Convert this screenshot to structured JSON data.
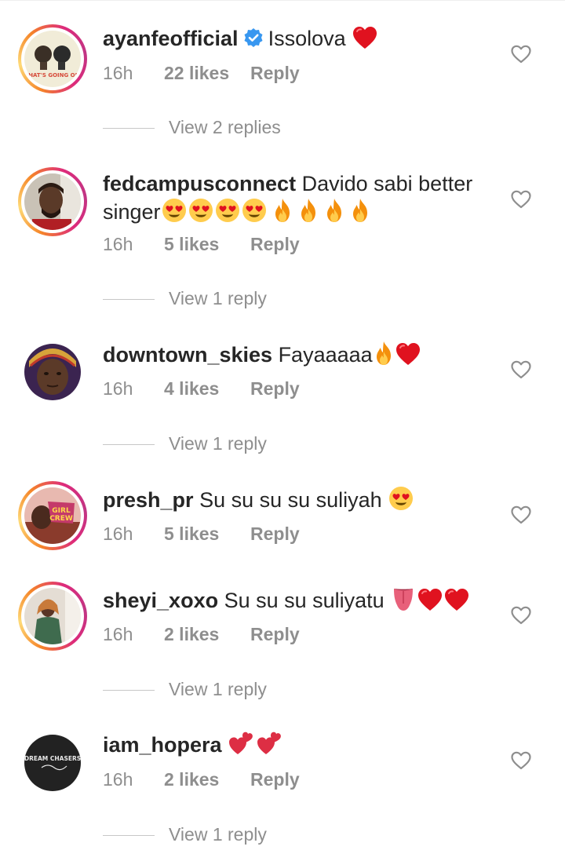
{
  "comments": [
    {
      "username": "ayanfeofficial",
      "verified": true,
      "text": "Issolova",
      "emojis": [
        "heart"
      ],
      "time": "16h",
      "likes": "22 likes",
      "reply": "Reply",
      "view_replies": "View 2 replies",
      "avatar_text": "WHAT'S GOING ON?"
    },
    {
      "username": "fedcampusconnect",
      "verified": false,
      "text": "Davido sabi better singer",
      "emojis": [
        "heart-eyes",
        "heart-eyes",
        "heart-eyes",
        "heart-eyes",
        "fire",
        "fire",
        "fire",
        "fire"
      ],
      "time": "16h",
      "likes": "5 likes",
      "reply": "Reply",
      "view_replies": "View 1 reply"
    },
    {
      "username": "downtown_skies",
      "verified": false,
      "text": "Fayaaaaa",
      "emojis": [
        "fire",
        "heart"
      ],
      "time": "16h",
      "likes": "4 likes",
      "reply": "Reply",
      "view_replies": "View 1 reply"
    },
    {
      "username": "presh_pr",
      "verified": false,
      "text": "Su su su su suliyah",
      "emojis": [
        "heart-eyes"
      ],
      "time": "16h",
      "likes": "5 likes",
      "reply": "Reply",
      "view_replies": ""
    },
    {
      "username": "sheyi_xoxo",
      "verified": false,
      "text": "Su su su suliyatu",
      "emojis": [
        "tongue",
        "heart",
        "heart"
      ],
      "time": "16h",
      "likes": "2 likes",
      "reply": "Reply",
      "view_replies": "View 1 reply"
    },
    {
      "username": "iam_hopera",
      "verified": false,
      "text": "",
      "emojis": [
        "two-hearts",
        "two-hearts"
      ],
      "time": "16h",
      "likes": "2 likes",
      "reply": "Reply",
      "view_replies": "View 1 reply",
      "avatar_text": "DREAM CHASERS"
    }
  ],
  "colors": {
    "text": "#262626",
    "muted": "#8e8e8e",
    "verified_blue": "#3897f0",
    "heart_red": "#ed1c24"
  },
  "icons": {
    "like": "heart-outline-icon",
    "verified": "verified-badge-icon"
  }
}
